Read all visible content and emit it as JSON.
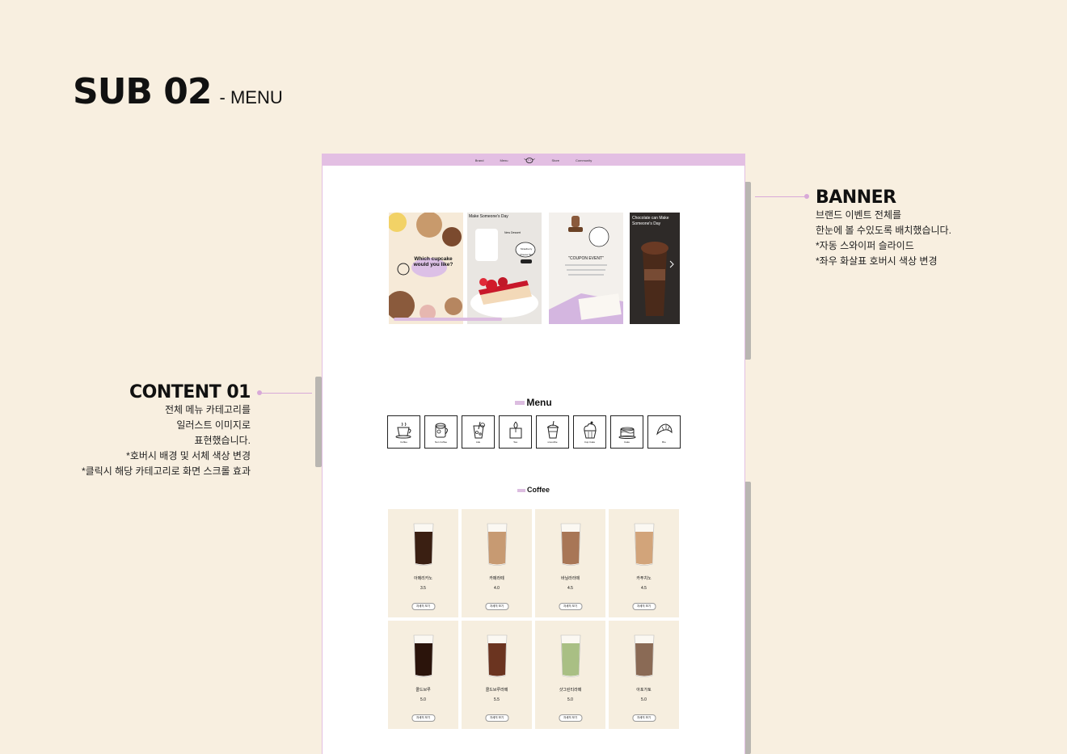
{
  "page": {
    "title_big": "SUB 02",
    "title_small": "- MENU"
  },
  "annotations": {
    "banner": {
      "title": "BANNER",
      "lines": [
        "브랜드 이벤트 전체를",
        "한눈에 볼 수있도록 배치했습니다.",
        "*자동 스와이퍼 슬라이드",
        "*좌우 화살표 호버시 색상 변경"
      ]
    },
    "content01": {
      "title": "CONTENT 01",
      "lines": [
        "전체 메뉴 카테고리를",
        "일러스트 이미지로",
        "표현했습니다.",
        "*호버시 배경 및 서체 색상 변경",
        "*클릭시 해당 카테고리로 화면 스크롤 효과"
      ]
    }
  },
  "mock": {
    "nav": [
      "Brand",
      "Menu",
      "Store",
      "Community"
    ],
    "banner": {
      "slides": [
        {
          "caption": "Which cupcake would you like?"
        },
        {
          "caption": "Make Someone's Day",
          "tag": "Strawberry Cheese Tart",
          "sub": "New Dessert"
        },
        {
          "caption": "\"COUPON EVENT\""
        },
        {
          "caption": "Chocolate can Make Someone's Day"
        }
      ]
    },
    "menu_title": "Menu",
    "categories": [
      {
        "label": "Coffee",
        "icon": "coffee-cup-icon"
      },
      {
        "label": "Non Coffee",
        "icon": "mug-icon"
      },
      {
        "label": "Ade",
        "icon": "ade-glass-icon"
      },
      {
        "label": "Tea",
        "icon": "tea-bag-icon"
      },
      {
        "label": "smoothie",
        "icon": "smoothie-cup-icon"
      },
      {
        "label": "Cup Cake",
        "icon": "cupcake-icon"
      },
      {
        "label": "Cake",
        "icon": "cake-icon"
      },
      {
        "label": "Bre",
        "icon": "croissant-icon"
      }
    ],
    "coffee_title": "Coffee",
    "products": [
      {
        "name": "아메리카노",
        "price": "3.5",
        "button": "자세히 보기",
        "color": "#3a1f12"
      },
      {
        "name": "카페라떼",
        "price": "4.0",
        "button": "자세히 보기",
        "color": "#c79a72"
      },
      {
        "name": "바닐라라떼",
        "price": "4.5",
        "button": "자세히 보기",
        "color": "#a87656"
      },
      {
        "name": "카푸치노",
        "price": "4.5",
        "button": "자세히 보기",
        "color": "#d2a47a"
      },
      {
        "name": "콜드브루",
        "price": "5.0",
        "button": "자세히 보기",
        "color": "#2b140b"
      },
      {
        "name": "콜드브루라떼",
        "price": "5.5",
        "button": "자세히 보기",
        "color": "#6b3420"
      },
      {
        "name": "샷그린티라떼",
        "price": "5.0",
        "button": "자세히 보기",
        "color": "#a9bf84"
      },
      {
        "name": "아포가토",
        "price": "5.0",
        "button": "자세히 보기",
        "color": "#8a6a55"
      }
    ]
  }
}
